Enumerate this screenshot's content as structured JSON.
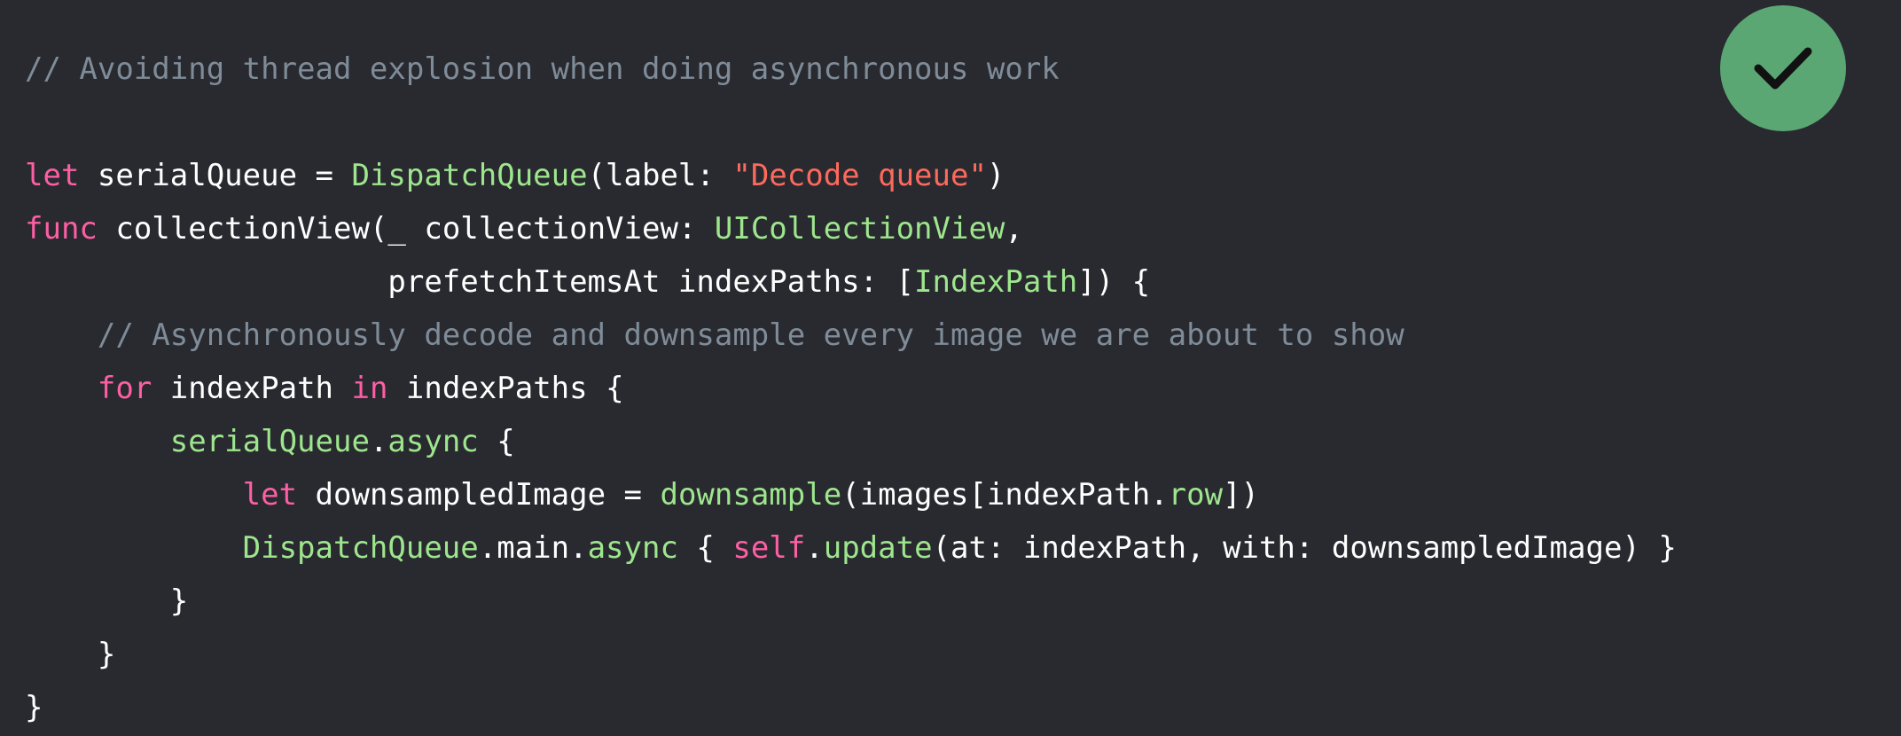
{
  "colors": {
    "background": "#292a30",
    "comment": "#7f8c98",
    "keyword": "#fc5fa3",
    "type": "#9ef1dd",
    "function": "#9ee68d",
    "string": "#fc6a5d",
    "plain": "#ffffff",
    "badge": "#5aa774"
  },
  "badge": {
    "icon": "checkmark-icon"
  },
  "code": {
    "lines": [
      [
        {
          "t": "// Avoiding thread explosion when doing asynchronous work",
          "k": "comment"
        }
      ],
      [],
      [
        {
          "t": "let",
          "k": "keyword"
        },
        {
          "t": " serialQueue = ",
          "k": "plain"
        },
        {
          "t": "DispatchQueue",
          "k": "func"
        },
        {
          "t": "(label: ",
          "k": "plain"
        },
        {
          "t": "\"Decode queue\"",
          "k": "string"
        },
        {
          "t": ")",
          "k": "plain"
        }
      ],
      [
        {
          "t": "func",
          "k": "keyword"
        },
        {
          "t": " collectionView(_ collectionView: ",
          "k": "plain"
        },
        {
          "t": "UICollectionView",
          "k": "func"
        },
        {
          "t": ",",
          "k": "plain"
        }
      ],
      [
        {
          "t": "                    prefetchItemsAt indexPaths: [",
          "k": "plain"
        },
        {
          "t": "IndexPath",
          "k": "func"
        },
        {
          "t": "]) {",
          "k": "plain"
        }
      ],
      [
        {
          "t": "    // Asynchronously decode and downsample every image we are about to show",
          "k": "comment"
        }
      ],
      [
        {
          "t": "    ",
          "k": "plain"
        },
        {
          "t": "for",
          "k": "keyword"
        },
        {
          "t": " indexPath ",
          "k": "plain"
        },
        {
          "t": "in",
          "k": "keyword"
        },
        {
          "t": " indexPaths {",
          "k": "plain"
        }
      ],
      [
        {
          "t": "        ",
          "k": "plain"
        },
        {
          "t": "serialQueue",
          "k": "func"
        },
        {
          "t": ".",
          "k": "plain"
        },
        {
          "t": "async",
          "k": "func"
        },
        {
          "t": " {",
          "k": "plain"
        }
      ],
      [
        {
          "t": "            ",
          "k": "plain"
        },
        {
          "t": "let",
          "k": "keyword"
        },
        {
          "t": " downsampledImage = ",
          "k": "plain"
        },
        {
          "t": "downsample",
          "k": "func"
        },
        {
          "t": "(images[indexPath.",
          "k": "plain"
        },
        {
          "t": "row",
          "k": "func"
        },
        {
          "t": "])",
          "k": "plain"
        }
      ],
      [
        {
          "t": "            ",
          "k": "plain"
        },
        {
          "t": "DispatchQueue",
          "k": "func"
        },
        {
          "t": ".main.",
          "k": "plain"
        },
        {
          "t": "async",
          "k": "func"
        },
        {
          "t": " { ",
          "k": "plain"
        },
        {
          "t": "self",
          "k": "keyword"
        },
        {
          "t": ".",
          "k": "plain"
        },
        {
          "t": "update",
          "k": "func"
        },
        {
          "t": "(at: indexPath, with: downsampledImage) }",
          "k": "plain"
        }
      ],
      [
        {
          "t": "        }",
          "k": "plain"
        }
      ],
      [
        {
          "t": "    }",
          "k": "plain"
        }
      ],
      [
        {
          "t": "}",
          "k": "plain"
        }
      ]
    ]
  }
}
